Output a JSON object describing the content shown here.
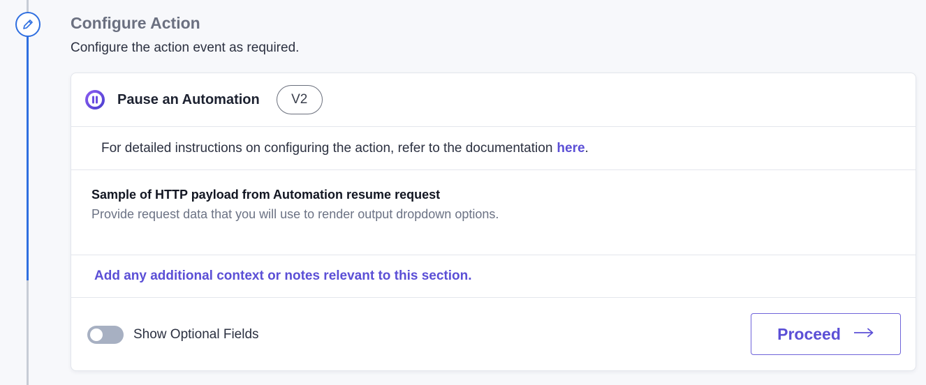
{
  "header": {
    "title": "Configure Action",
    "subtitle": "Configure the action event as required."
  },
  "action": {
    "name": "Pause an Automation",
    "version": "V2",
    "icon": "pause-circle-icon"
  },
  "documentation": {
    "text": "For detailed instructions on configuring the action, refer to the documentation",
    "link_label": "here",
    "trailing": "."
  },
  "payload_field": {
    "label": "Sample of HTTP payload from Automation resume request",
    "description": "Provide request data that you will use to render output dropdown options."
  },
  "notes_link": "Add any additional context or notes relevant to this section.",
  "footer": {
    "toggle_label": "Show Optional Fields",
    "toggle_on": false,
    "proceed_label": "Proceed"
  },
  "colors": {
    "accent": "#5b4fd6",
    "timeline": "#2f6fe0",
    "toggle_off": "#a7b0c2"
  }
}
